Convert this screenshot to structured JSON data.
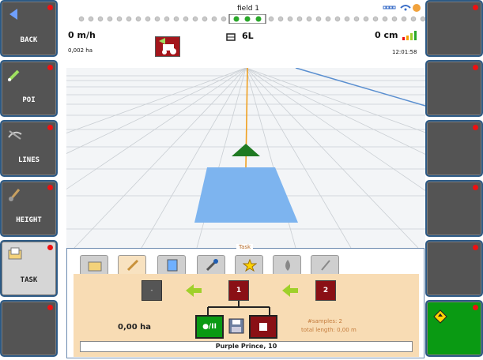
{
  "left_buttons": [
    {
      "label": "BACK",
      "icon": "back-arrow-icon"
    },
    {
      "label": "POI",
      "icon": "poi-pen-icon"
    },
    {
      "label": "LINES",
      "icon": "lines-icon"
    },
    {
      "label": "HEIGHT",
      "icon": "height-shovel-icon"
    },
    {
      "label": "TASK",
      "icon": "task-icon",
      "active": true
    },
    {
      "label": "",
      "icon": ""
    }
  ],
  "right_buttons": [
    {
      "label": ""
    },
    {
      "label": ""
    },
    {
      "label": ""
    },
    {
      "label": ""
    },
    {
      "label": ""
    },
    {
      "label": "",
      "icon": "compass-diamond-icon"
    }
  ],
  "header": {
    "field_name": "field 1",
    "speed": "0 m/h",
    "area": "0,002 ha",
    "section_label": "6L",
    "offset": "0 cm",
    "clock": "12:01:58"
  },
  "task_panel": {
    "title": "Task",
    "tabs": [
      "folder",
      "pencil",
      "notes",
      "wrench",
      "star",
      "drop",
      "shovel"
    ],
    "node_left": "-",
    "node_mid": "1",
    "node_right": "2",
    "area": "0,00 ha",
    "samples": "#samples:  2",
    "total_length": "total length:  0,00 m",
    "record_label": "●/II",
    "product": "Purple Prince, 10"
  },
  "colors": {
    "accent": "#2d5a85",
    "red": "#8a1015",
    "green": "#0a9a13",
    "panel": "#f8dcb4"
  }
}
